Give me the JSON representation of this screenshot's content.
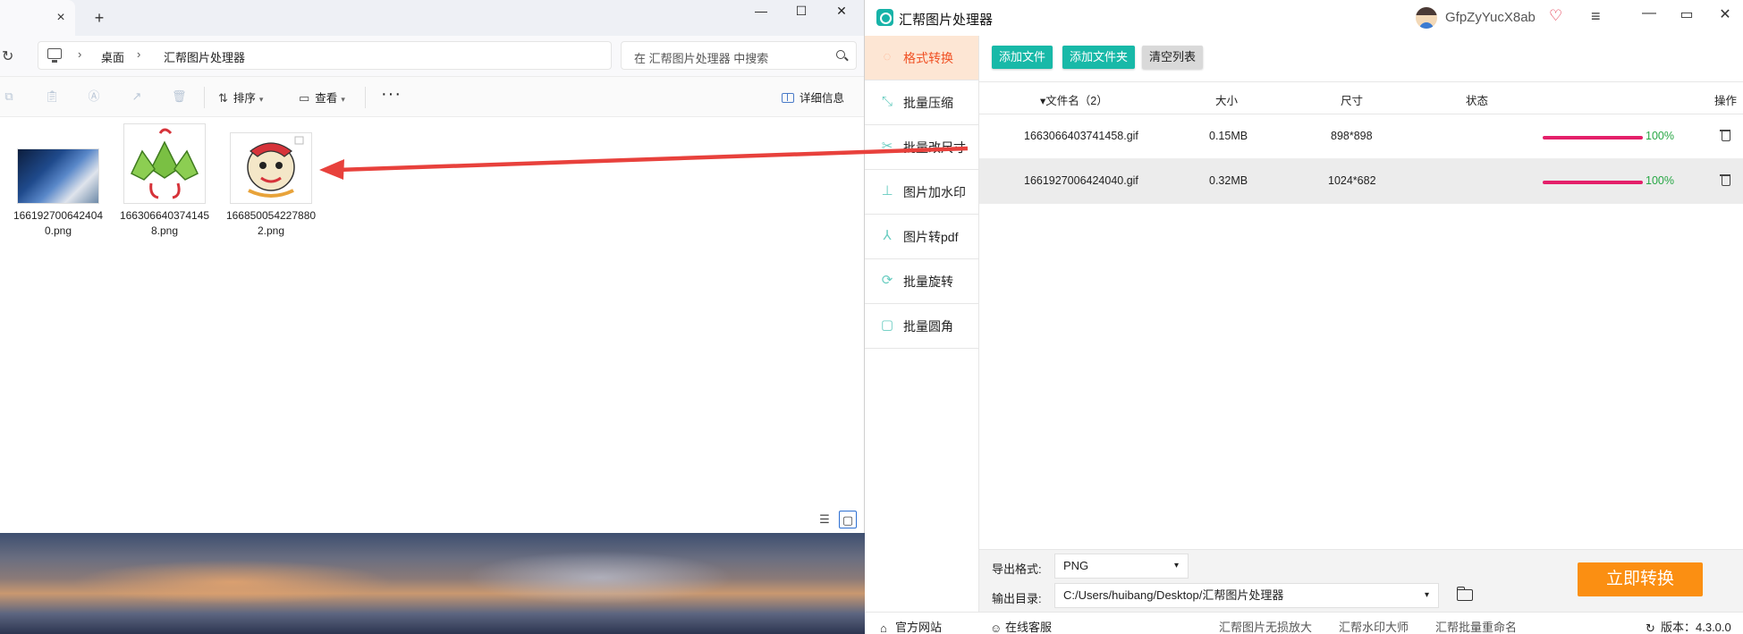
{
  "explorer": {
    "tab_close": "×",
    "new_tab": "+",
    "window_controls": {
      "minimize": "—",
      "maximize": "☐",
      "close": "✕"
    },
    "refresh": "↻",
    "breadcrumb": [
      "桌面",
      "汇帮图片处理器"
    ],
    "breadcrumb_sep": "›",
    "search_placeholder": "在 汇帮图片处理器 中搜索",
    "toolbar": {
      "sort": "排序",
      "view": "查看",
      "more": "···",
      "details": "详细信息"
    },
    "files": [
      {
        "name": "1661927006424040.png"
      },
      {
        "name": "1663066403741458.png"
      },
      {
        "name": "1668500542278802.png"
      }
    ]
  },
  "app": {
    "title": "汇帮图片处理器",
    "username": "GfpZyYucX8ab",
    "vip_icon": "♡",
    "menu_icon": "≡",
    "window_controls": {
      "minimize": "—",
      "maximize": "▭",
      "close": "✕"
    },
    "sidebar": [
      {
        "label": "格式转换",
        "icon": "convert-icon",
        "glyph": "◌",
        "active": true
      },
      {
        "label": "批量压缩",
        "icon": "compress-icon",
        "glyph": "⤡",
        "active": false
      },
      {
        "label": "批量改尺寸",
        "icon": "resize-icon",
        "glyph": "✂",
        "active": false
      },
      {
        "label": "图片加水印",
        "icon": "watermark-icon",
        "glyph": "⊥",
        "active": false
      },
      {
        "label": "图片转pdf",
        "icon": "pdf-icon",
        "glyph": "⅄",
        "active": false
      },
      {
        "label": "批量旋转",
        "icon": "rotate-icon",
        "glyph": "⟳",
        "active": false
      },
      {
        "label": "批量圆角",
        "icon": "round-corner-icon",
        "glyph": "▢",
        "active": false
      }
    ],
    "actions": {
      "add_file": "添加文件",
      "add_folder": "添加文件夹",
      "clear_list": "清空列表"
    },
    "table": {
      "headers": {
        "filename": "▾文件名（2）",
        "size": "大小",
        "dimensions": "尺寸",
        "status": "状态",
        "action": "操作"
      },
      "rows": [
        {
          "filename": "1663066403741458.gif",
          "size": "0.15MB",
          "dimensions": "898*898",
          "progress": 1.0,
          "percent": "100%"
        },
        {
          "filename": "1661927006424040.gif",
          "size": "0.32MB",
          "dimensions": "1024*682",
          "progress": 1.0,
          "percent": "100%"
        }
      ]
    },
    "output": {
      "format_label": "导出格式:",
      "format_value": "PNG",
      "dir_label": "输出目录:",
      "dir_value": "C:/Users/huibang/Desktop/汇帮图片处理器",
      "dropdown_caret": "▾"
    },
    "convert_button": "立即转换",
    "footer": {
      "website": "官方网站",
      "support": "在线客服",
      "link1": "汇帮图片无损放大",
      "link2": "汇帮水印大师",
      "link3": "汇帮批量重命名",
      "version": "版本：4.3.0.0"
    }
  },
  "colors": {
    "accent_teal": "#18b9a8",
    "active_tab_bg": "#fde6d4",
    "active_tab_text": "#f05023",
    "progress": "#e4206a",
    "percent_text": "#28a745",
    "convert_orange": "#fb8f12",
    "arrow_red": "#e8413c"
  }
}
